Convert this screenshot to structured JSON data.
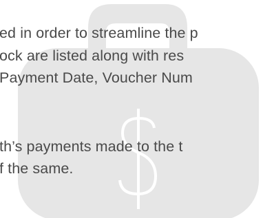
{
  "document": {
    "paragraph_1": {
      "line_1": "ed in order to streamline the p",
      "line_2": "ock are listed along with res",
      "line_3": "Payment Date, Voucher Num"
    },
    "paragraph_2": {
      "line_1": "th’s payments made to the t",
      "line_2": "f the same."
    }
  },
  "watermark": {
    "icon": "money-bag-dollar-icon",
    "color": "#e6e6e6"
  }
}
